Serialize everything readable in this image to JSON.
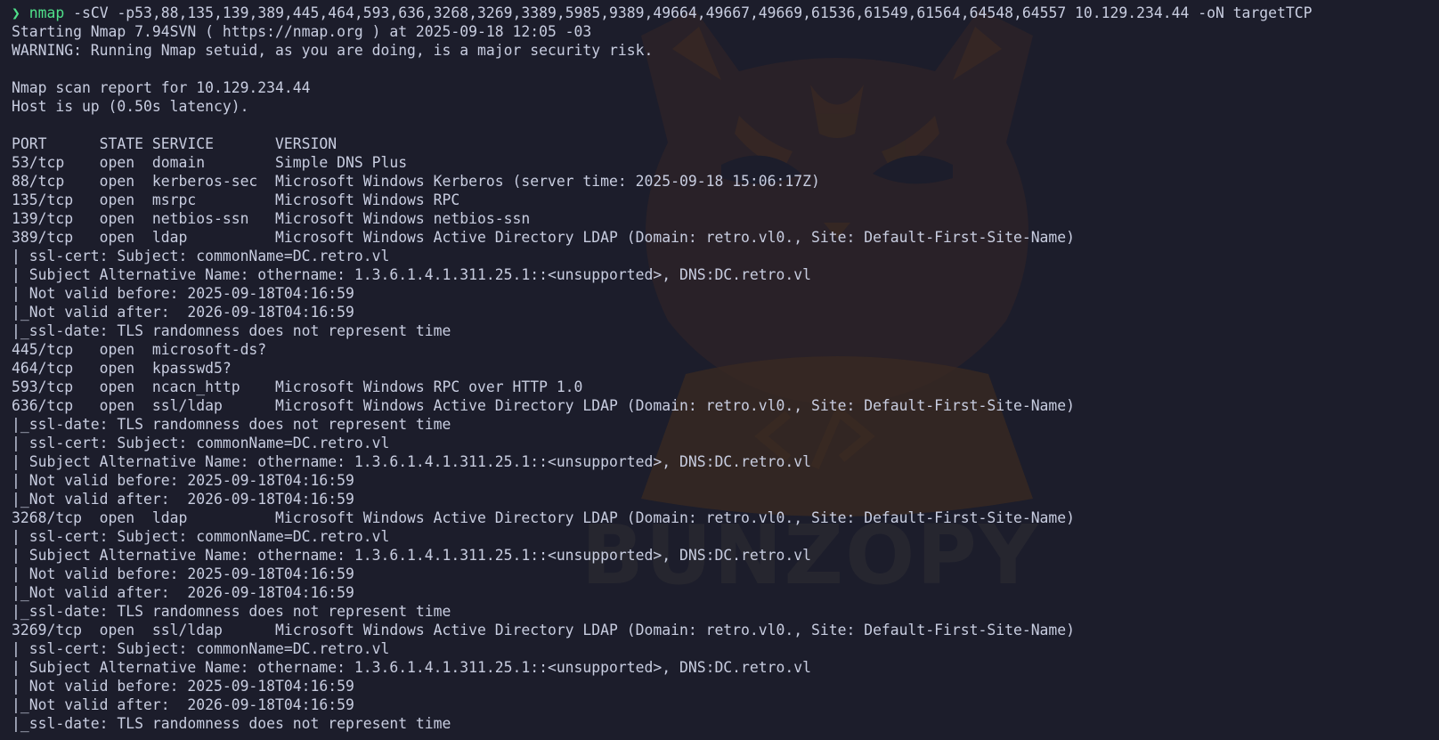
{
  "terminal": {
    "prompt_symbol": "❯",
    "command_name": "nmap",
    "command_args": " -sCV -p53,88,135,139,389,445,464,593,636,3268,3269,3389,5985,9389,49664,49667,49669,61536,61549,61564,64548,64557 10.129.234.44 -oN targetTCP",
    "colors": {
      "background": "#1c1d2b",
      "text": "#c8cde0",
      "prompt": "#4fe08a",
      "watermark": "#3a2a22"
    },
    "watermark_text": "BUNZOPY",
    "watermark_icon": "code-brackets-icon",
    "output": [
      "Starting Nmap 7.94SVN ( https://nmap.org ) at 2025-09-18 12:05 -03",
      "WARNING: Running Nmap setuid, as you are doing, is a major security risk.",
      "",
      "Nmap scan report for 10.129.234.44",
      "Host is up (0.50s latency).",
      "",
      "PORT      STATE SERVICE       VERSION",
      "53/tcp    open  domain        Simple DNS Plus",
      "88/tcp    open  kerberos-sec  Microsoft Windows Kerberos (server time: 2025-09-18 15:06:17Z)",
      "135/tcp   open  msrpc         Microsoft Windows RPC",
      "139/tcp   open  netbios-ssn   Microsoft Windows netbios-ssn",
      "389/tcp   open  ldap          Microsoft Windows Active Directory LDAP (Domain: retro.vl0., Site: Default-First-Site-Name)",
      "| ssl-cert: Subject: commonName=DC.retro.vl",
      "| Subject Alternative Name: othername: 1.3.6.1.4.1.311.25.1::<unsupported>, DNS:DC.retro.vl",
      "| Not valid before: 2025-09-18T04:16:59",
      "|_Not valid after:  2026-09-18T04:16:59",
      "|_ssl-date: TLS randomness does not represent time",
      "445/tcp   open  microsoft-ds?",
      "464/tcp   open  kpasswd5?",
      "593/tcp   open  ncacn_http    Microsoft Windows RPC over HTTP 1.0",
      "636/tcp   open  ssl/ldap      Microsoft Windows Active Directory LDAP (Domain: retro.vl0., Site: Default-First-Site-Name)",
      "|_ssl-date: TLS randomness does not represent time",
      "| ssl-cert: Subject: commonName=DC.retro.vl",
      "| Subject Alternative Name: othername: 1.3.6.1.4.1.311.25.1::<unsupported>, DNS:DC.retro.vl",
      "| Not valid before: 2025-09-18T04:16:59",
      "|_Not valid after:  2026-09-18T04:16:59",
      "3268/tcp  open  ldap          Microsoft Windows Active Directory LDAP (Domain: retro.vl0., Site: Default-First-Site-Name)",
      "| ssl-cert: Subject: commonName=DC.retro.vl",
      "| Subject Alternative Name: othername: 1.3.6.1.4.1.311.25.1::<unsupported>, DNS:DC.retro.vl",
      "| Not valid before: 2025-09-18T04:16:59",
      "|_Not valid after:  2026-09-18T04:16:59",
      "|_ssl-date: TLS randomness does not represent time",
      "3269/tcp  open  ssl/ldap      Microsoft Windows Active Directory LDAP (Domain: retro.vl0., Site: Default-First-Site-Name)",
      "| ssl-cert: Subject: commonName=DC.retro.vl",
      "| Subject Alternative Name: othername: 1.3.6.1.4.1.311.25.1::<unsupported>, DNS:DC.retro.vl",
      "| Not valid before: 2025-09-18T04:16:59",
      "|_Not valid after:  2026-09-18T04:16:59",
      "|_ssl-date: TLS randomness does not represent time"
    ]
  }
}
